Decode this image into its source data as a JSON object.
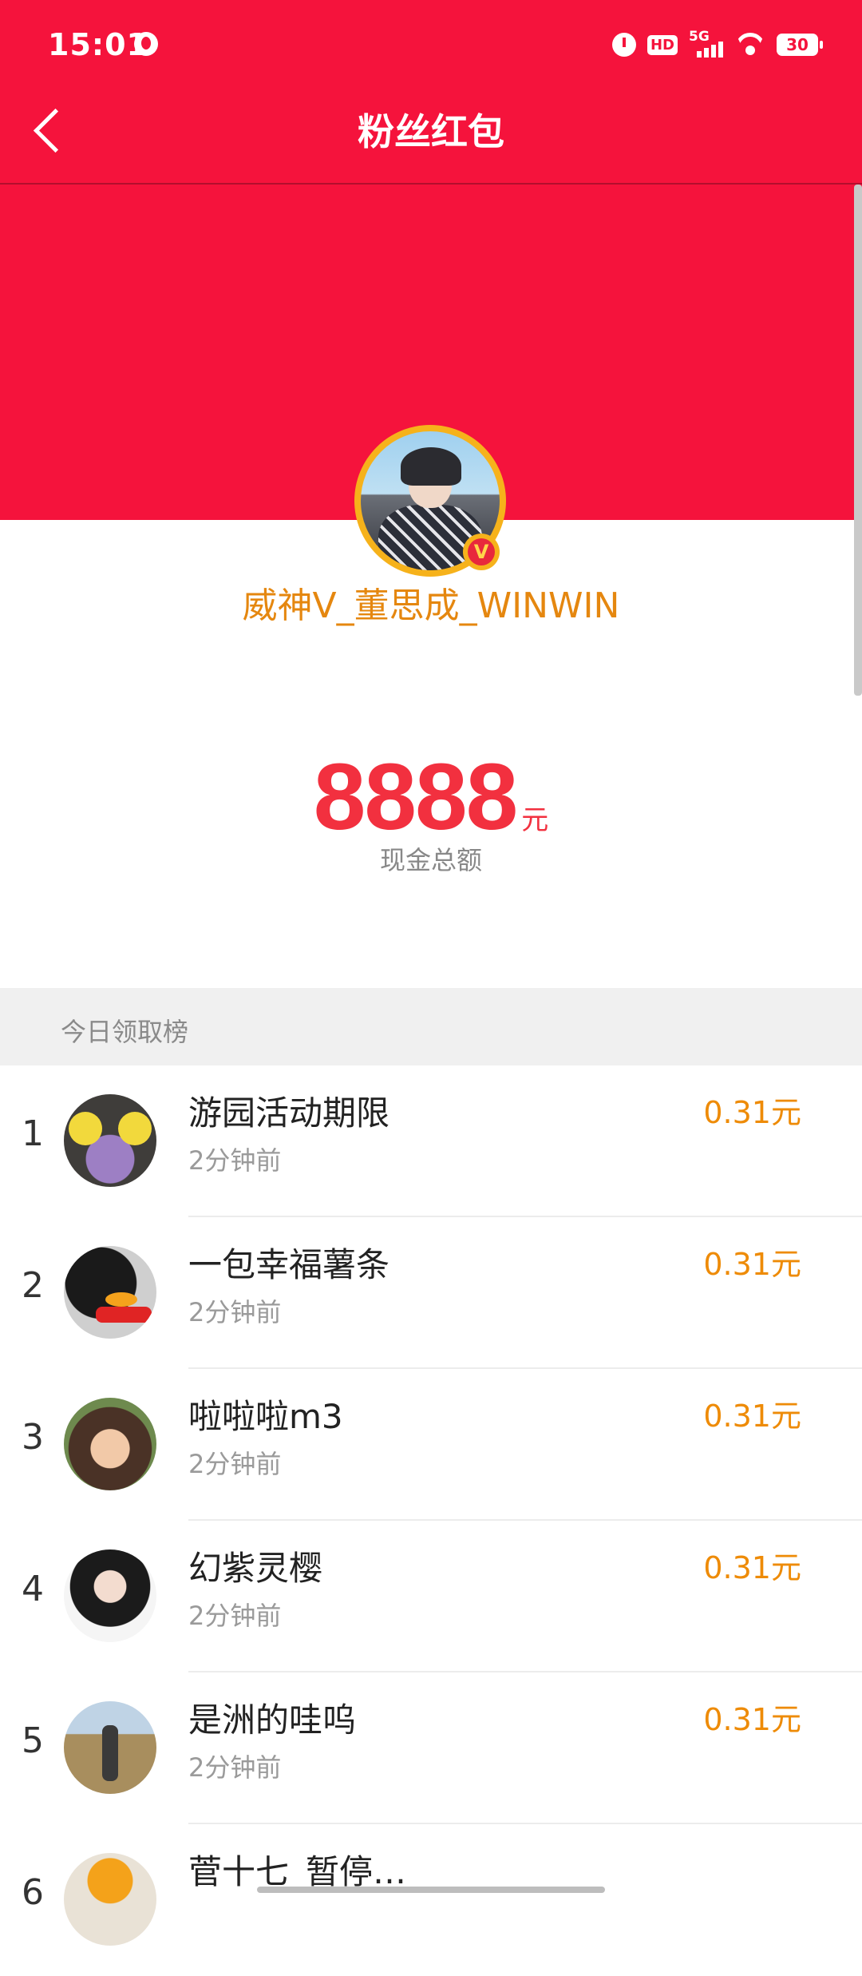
{
  "status_bar": {
    "time": "15:01",
    "network": "5G",
    "hd": "HD",
    "battery": "30",
    "icons": [
      "globe-icon",
      "alarm-icon",
      "hd-icon",
      "signal-icon",
      "wifi-icon",
      "battery-icon"
    ]
  },
  "header": {
    "title": "粉丝红包",
    "back_icon": "chevron-left-icon"
  },
  "profile": {
    "username": "威神V_董思成_WINWIN",
    "verified_badge": "V"
  },
  "summary": {
    "amount": "8888",
    "unit": "元",
    "label": "现金总额"
  },
  "leaderboard": {
    "title": "今日领取榜",
    "rows": [
      {
        "rank": "1",
        "name": "游园活动期限",
        "time": "2分钟前",
        "amount": "0.31元"
      },
      {
        "rank": "2",
        "name": "一包幸福薯条",
        "time": "2分钟前",
        "amount": "0.31元"
      },
      {
        "rank": "3",
        "name": "啦啦啦m3",
        "time": "2分钟前",
        "amount": "0.31元"
      },
      {
        "rank": "4",
        "name": "幻紫灵樱",
        "time": "2分钟前",
        "amount": "0.31元"
      },
      {
        "rank": "5",
        "name": "是洲的哇呜",
        "time": "2分钟前",
        "amount": "0.31元"
      },
      {
        "rank": "6",
        "name": "菅十七_暂停…",
        "time": "",
        "amount": ""
      }
    ]
  },
  "colors": {
    "primary_red": "#f5133c",
    "gold": "#f6b21b",
    "amount_orange": "#ee8b07",
    "username_orange": "#e5870f"
  }
}
